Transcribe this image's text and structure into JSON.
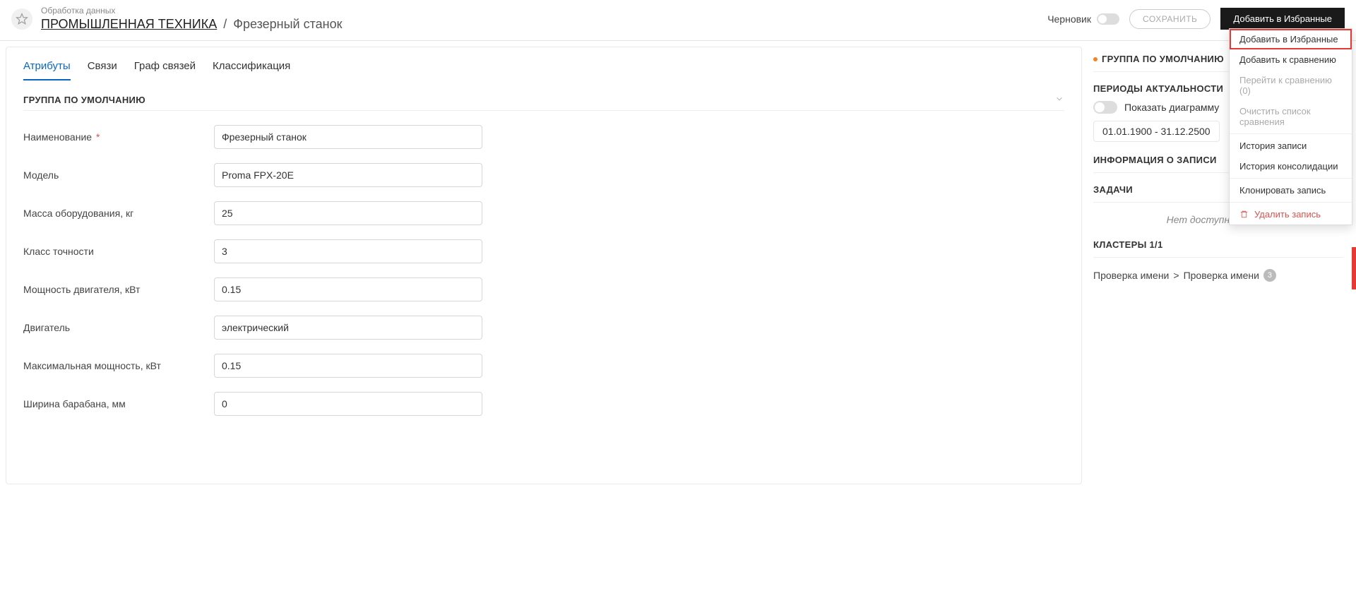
{
  "header": {
    "subtitle": "Обработка данных",
    "breadcrumb_root": "ПРОМЫШЛЕННАЯ ТЕХНИКА",
    "breadcrumb_current": "Фрезерный станок",
    "draft_label": "Черновик",
    "save_label": "СОХРАНИТЬ",
    "add_fav_label": "Добавить в Избранные"
  },
  "menu": {
    "items": [
      {
        "label": "Добавить в Избранные",
        "highlight": true
      },
      {
        "label": "Добавить к сравнению"
      },
      {
        "label": "Перейти к сравнению (0)",
        "disabled": true
      },
      {
        "label": "Очистить список сравнения",
        "disabled": true
      },
      {
        "separator": true
      },
      {
        "label": "История записи"
      },
      {
        "label": "История консолидации"
      },
      {
        "separator": true
      },
      {
        "label": "Клонировать запись"
      },
      {
        "separator": true
      },
      {
        "label": "Удалить запись",
        "danger": true,
        "icon": "trash"
      }
    ]
  },
  "tabs": [
    "Атрибуты",
    "Связи",
    "Граф связей",
    "Классификация"
  ],
  "group_title": "ГРУППА ПО УМОЛЧАНИЮ",
  "form": [
    {
      "label": "Наименование",
      "required": true,
      "value": "Фрезерный станок"
    },
    {
      "label": "Модель",
      "value": "Proma FPX-20E"
    },
    {
      "label": "Масса оборудования, кг",
      "value": "25"
    },
    {
      "label": "Класс точности",
      "value": "3"
    },
    {
      "label": "Мощность двигателя, кВт",
      "value": "0.15"
    },
    {
      "label": "Двигатель",
      "value": "электрический"
    },
    {
      "label": "Максимальная мощность, кВт",
      "value": "0.15"
    },
    {
      "label": "Ширина барабана, мм",
      "value": "0"
    }
  ],
  "side": {
    "default_group": "ГРУППА ПО УМОЛЧАНИЮ",
    "periods_title": "ПЕРИОДЫ АКТУАЛЬНОСТИ",
    "show_diagram": "Показать диаграмму",
    "period_range": "01.01.1900 - 31.12.2500",
    "record_info": "ИНФОРМАЦИЯ О ЗАПИСИ",
    "tasks_title": "ЗАДАЧИ",
    "no_tasks": "Нет доступных задач",
    "clusters_title": "КЛАСТЕРЫ 1/1",
    "cluster_path_a": "Проверка имени",
    "cluster_path_b": "Проверка имени",
    "cluster_badge": "3"
  }
}
